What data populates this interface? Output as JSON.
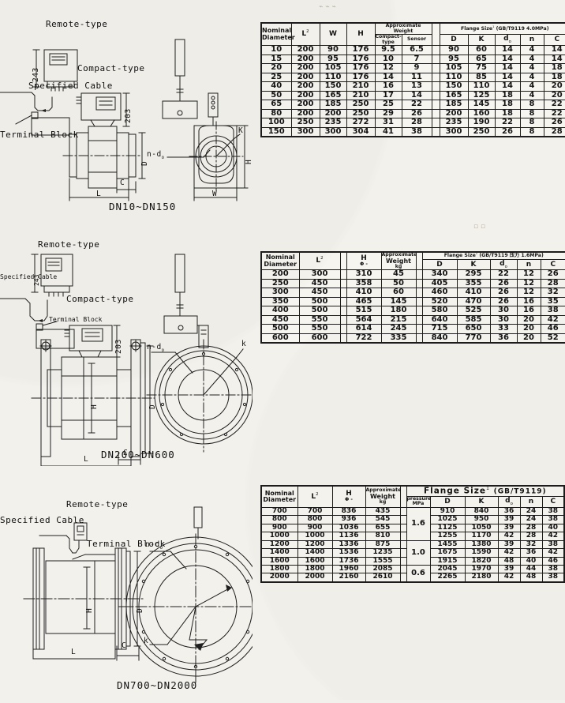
{
  "drawings": [
    {
      "id": "dn10-150",
      "caption": "DN10~DN150",
      "remote_label": "Remote-type",
      "compact_label": "Compact-type",
      "cable_label": "Specified Cable",
      "terminal_label": "Terminal Block",
      "dim_converter_height": "243",
      "dim_compact_height": "203",
      "dims": {
        "D": "D",
        "L": "L",
        "C": "C",
        "W": "W",
        "H": "H",
        "K": "K",
        "nd": "n-d",
        "nd_sub": "o"
      }
    },
    {
      "id": "dn200-600",
      "caption": "DN200~DN600",
      "remote_label": "Remote-type",
      "compact_label": "Compact-type",
      "cable_label": "Specified Cable",
      "terminal_label": "Terminal Block",
      "dim_converter_height": "243",
      "dim_compact_height": "203",
      "dims": {
        "D": "D",
        "L": "L",
        "C": "C",
        "H": "H",
        "K": "k",
        "nd": "n-d",
        "nd_sub": "o"
      }
    },
    {
      "id": "dn700-2000",
      "caption": "DN700~DN2000",
      "remote_label": "Remote-type",
      "cable_label": "Specified Cable",
      "terminal_label": "Terminal Block",
      "dims": {
        "D": "D",
        "L": "L",
        "C": "C",
        "H": "H",
        "K": "k",
        "nd": "n-d",
        "nd_sub": "o"
      }
    }
  ],
  "table1": {
    "headers": {
      "nominal": "Nominal",
      "diameter": "Diameter",
      "L": "L",
      "L_sup": "2",
      "W": "W",
      "H": "H",
      "weight_group": "Approximate Weight",
      "weight_compact": "Compact-type",
      "weight_sensor": "Sensor",
      "flange_group": "Flange Size",
      "flange_sup": "1",
      "flange_std": "(GB/T9119    4.0MPa)",
      "D": "D",
      "K": "K",
      "d": "d",
      "d_sub": "o",
      "n": "n",
      "C": "C"
    },
    "rows": [
      {
        "dn": "10",
        "L": "200",
        "W": "90",
        "H": "176",
        "wc": "9.5",
        "ws": "6.5",
        "D": "90",
        "K": "60",
        "do": "14",
        "n": "4",
        "C": "14"
      },
      {
        "dn": "15",
        "L": "200",
        "W": "95",
        "H": "176",
        "wc": "10",
        "ws": "7",
        "D": "95",
        "K": "65",
        "do": "14",
        "n": "4",
        "C": "14"
      },
      {
        "dn": "20",
        "L": "200",
        "W": "105",
        "H": "176",
        "wc": "12",
        "ws": "9",
        "D": "105",
        "K": "75",
        "do": "14",
        "n": "4",
        "C": "18"
      },
      {
        "dn": "25",
        "L": "200",
        "W": "110",
        "H": "176",
        "wc": "14",
        "ws": "11",
        "D": "110",
        "K": "85",
        "do": "14",
        "n": "4",
        "C": "18"
      },
      {
        "dn": "40",
        "L": "200",
        "W": "150",
        "H": "210",
        "wc": "16",
        "ws": "13",
        "D": "150",
        "K": "110",
        "do": "14",
        "n": "4",
        "C": "20"
      },
      {
        "dn": "50",
        "L": "200",
        "W": "165",
        "H": "210",
        "wc": "17",
        "ws": "14",
        "D": "165",
        "K": "125",
        "do": "18",
        "n": "4",
        "C": "20"
      },
      {
        "dn": "65",
        "L": "200",
        "W": "185",
        "H": "250",
        "wc": "25",
        "ws": "22",
        "D": "185",
        "K": "145",
        "do": "18",
        "n": "8",
        "C": "22"
      },
      {
        "dn": "80",
        "L": "200",
        "W": "200",
        "H": "250",
        "wc": "29",
        "ws": "26",
        "D": "200",
        "K": "160",
        "do": "18",
        "n": "8",
        "C": "22"
      },
      {
        "dn": "100",
        "L": "250",
        "W": "235",
        "H": "272",
        "wc": "31",
        "ws": "28",
        "D": "235",
        "K": "190",
        "do": "22",
        "n": "8",
        "C": "26"
      },
      {
        "dn": "150",
        "L": "300",
        "W": "300",
        "H": "304",
        "wc": "41",
        "ws": "38",
        "D": "300",
        "K": "250",
        "do": "26",
        "n": "8",
        "C": "28"
      }
    ]
  },
  "table2": {
    "headers": {
      "nominal": "Nominal",
      "diameter": "Diameter",
      "L": "L",
      "L_sup": "2",
      "H": "H",
      "H_sub": "Φ -",
      "weight_1": "Approximate",
      "weight_2": "Weight",
      "weight_3": "kg",
      "flange_group": "Flange Size",
      "flange_sup": "1",
      "flange_std": "(GB/T9119    压力 1.6MPa)",
      "D": "D",
      "K": "K",
      "d": "d",
      "d_sub": "o",
      "n": "n",
      "C": "C"
    },
    "rows": [
      {
        "dn": "200",
        "L": "300",
        "H": "310",
        "w": "45",
        "D": "340",
        "K": "295",
        "do": "22",
        "n": "12",
        "C": "26"
      },
      {
        "dn": "250",
        "L": "450",
        "H": "358",
        "w": "50",
        "D": "405",
        "K": "355",
        "do": "26",
        "n": "12",
        "C": "28"
      },
      {
        "dn": "300",
        "L": "450",
        "H": "410",
        "w": "60",
        "D": "460",
        "K": "410",
        "do": "26",
        "n": "12",
        "C": "32"
      },
      {
        "dn": "350",
        "L": "500",
        "H": "465",
        "w": "145",
        "D": "520",
        "K": "470",
        "do": "26",
        "n": "16",
        "C": "35"
      },
      {
        "dn": "400",
        "L": "500",
        "H": "515",
        "w": "180",
        "D": "580",
        "K": "525",
        "do": "30",
        "n": "16",
        "C": "38"
      },
      {
        "dn": "450",
        "L": "550",
        "H": "564",
        "w": "215",
        "D": "640",
        "K": "585",
        "do": "30",
        "n": "20",
        "C": "42"
      },
      {
        "dn": "500",
        "L": "550",
        "H": "614",
        "w": "245",
        "D": "715",
        "K": "650",
        "do": "33",
        "n": "20",
        "C": "46"
      },
      {
        "dn": "600",
        "L": "600",
        "H": "722",
        "w": "335",
        "D": "840",
        "K": "770",
        "do": "36",
        "n": "20",
        "C": "52"
      }
    ]
  },
  "table3": {
    "headers": {
      "nominal": "Nominal",
      "diameter": "Diameter",
      "L": "L",
      "L_sup": "2",
      "H": "H",
      "H_sub": "Φ -",
      "weight_1": "Approximate",
      "weight_2": "Weight",
      "weight_3": "kg",
      "flange_group": "Flange Size",
      "flange_sup": "1",
      "flange_std": "(GB/T9119)",
      "pressure_1": "pressure",
      "pressure_2": "MPa",
      "D": "D",
      "K": "K",
      "d": "d",
      "d_sub": "o",
      "n": "n",
      "C": "C"
    },
    "pressure_groups": [
      {
        "value": "1.6",
        "span": 4
      },
      {
        "value": "1.0",
        "span": 3
      },
      {
        "value": "0.6",
        "span": 2
      }
    ],
    "rows": [
      {
        "dn": "700",
        "L": "700",
        "H": "836",
        "w": "435",
        "D": "910",
        "K": "840",
        "do": "36",
        "n": "24",
        "C": "38"
      },
      {
        "dn": "800",
        "L": "800",
        "H": "936",
        "w": "545",
        "D": "1025",
        "K": "950",
        "do": "39",
        "n": "24",
        "C": "38"
      },
      {
        "dn": "900",
        "L": "900",
        "H": "1036",
        "w": "655",
        "D": "1125",
        "K": "1050",
        "do": "39",
        "n": "28",
        "C": "40"
      },
      {
        "dn": "1000",
        "L": "1000",
        "H": "1136",
        "w": "810",
        "D": "1255",
        "K": "1170",
        "do": "42",
        "n": "28",
        "C": "42"
      },
      {
        "dn": "1200",
        "L": "1200",
        "H": "1336",
        "w": "875",
        "D": "1455",
        "K": "1380",
        "do": "39",
        "n": "32",
        "C": "38"
      },
      {
        "dn": "1400",
        "L": "1400",
        "H": "1536",
        "w": "1235",
        "D": "1675",
        "K": "1590",
        "do": "42",
        "n": "36",
        "C": "42"
      },
      {
        "dn": "1600",
        "L": "1600",
        "H": "1736",
        "w": "1555",
        "D": "1915",
        "K": "1820",
        "do": "48",
        "n": "40",
        "C": "46"
      },
      {
        "dn": "1800",
        "L": "1800",
        "H": "1960",
        "w": "2085",
        "D": "2045",
        "K": "1970",
        "do": "39",
        "n": "44",
        "C": "38"
      },
      {
        "dn": "2000",
        "L": "2000",
        "H": "2160",
        "w": "2610",
        "D": "2265",
        "K": "2180",
        "do": "42",
        "n": "48",
        "C": "38"
      }
    ]
  }
}
